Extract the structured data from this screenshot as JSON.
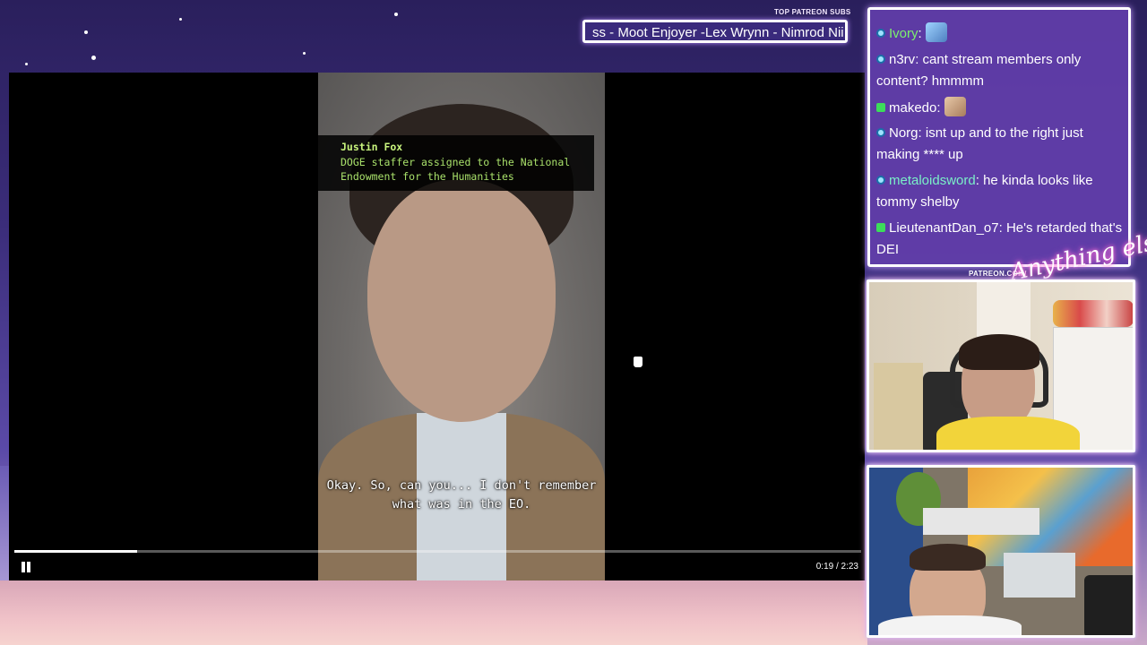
{
  "ticker": {
    "title": "TOP PATREON SUBS",
    "text": "ss - Moot Enjoyer -Lex Wrynn - Nimrod Nii"
  },
  "video": {
    "lower_third_name": "Justin Fox",
    "lower_third_role": "DOGE staffer assigned to the National Endowment for the Humanities",
    "caption": "Okay. So, can you... I don't remember what was in the EO.",
    "time": "0:19 / 2:23",
    "progress": 0.145
  },
  "chat": {
    "messages": [
      {
        "user": "Ivory",
        "user_color": "#7cf06e",
        "badge": "blue",
        "text": "",
        "emote": "avatar-emote"
      },
      {
        "user": "n3rv",
        "user_color": "#ffffff",
        "badge": "blue",
        "text": "cant stream members only content? hmmmm",
        "emote": ""
      },
      {
        "user": "makedo",
        "user_color": "#ffffff",
        "badge": "green",
        "text": "",
        "emote": "cat-emote"
      },
      {
        "user": "Norg",
        "user_color": "#ffffff",
        "badge": "blue",
        "text": "isnt up and to the right just making **** up",
        "emote": ""
      },
      {
        "user": "metaloidsword",
        "user_color": "#7af0c8",
        "badge": "blue",
        "text": "he kinda looks like tommy shelby",
        "emote": ""
      },
      {
        "user": "LieutenantDan_o7",
        "user_color": "#ffffff",
        "badge": "green",
        "text": "He's retarded that's DEI",
        "emote": ""
      }
    ]
  },
  "overlay": {
    "patreon_label": "PATREON.COM/",
    "logo_text": "Anything else?"
  },
  "colors": {
    "accent_green": "#c8f37d",
    "chat_bg": "#623eaa",
    "badge_green": "#3cdc5a"
  }
}
